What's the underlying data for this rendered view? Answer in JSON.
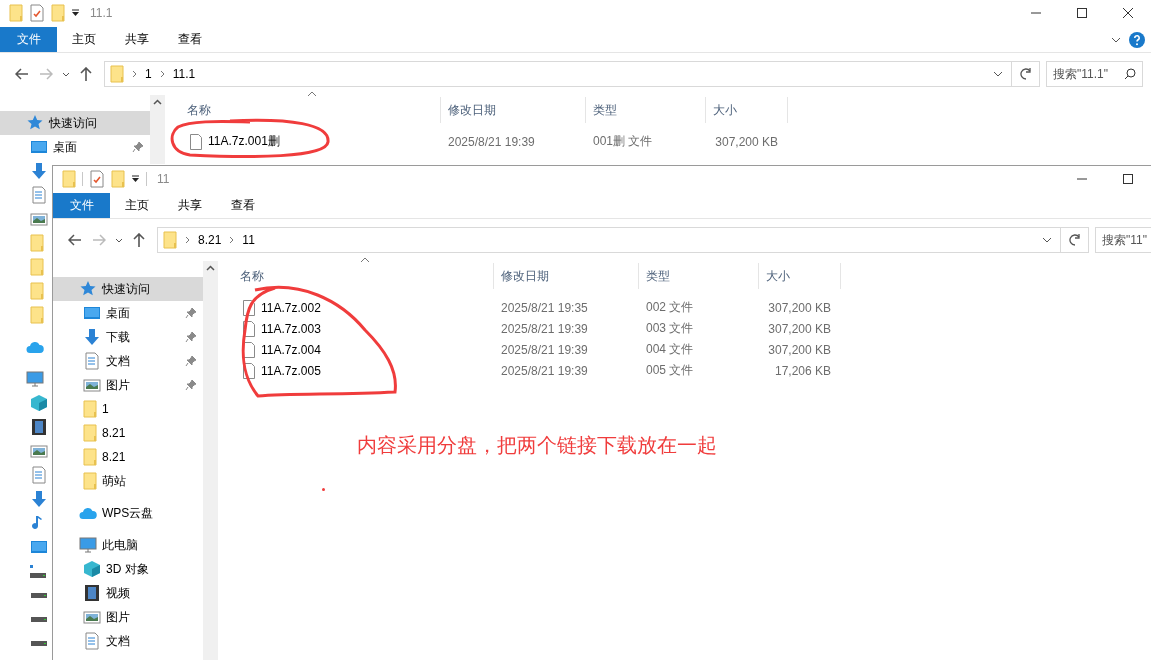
{
  "back_window": {
    "title": "11.1",
    "ribbon_tabs": [
      {
        "label": "文件",
        "selected": true
      },
      {
        "label": "主页",
        "selected": false
      },
      {
        "label": "共享",
        "selected": false
      },
      {
        "label": "查看",
        "selected": false
      }
    ],
    "path": [
      "1",
      "11.1"
    ],
    "search": {
      "placeholder": "搜索\"11.1\""
    },
    "nav": [
      {
        "kind": "star",
        "label": "快速访问",
        "selected": true
      },
      {
        "kind": "desktop",
        "label": "桌面",
        "pinned": true,
        "selected": false
      },
      {
        "kind": "download"
      },
      {
        "kind": "document"
      },
      {
        "kind": "picture"
      },
      {
        "kind": "folder"
      },
      {
        "kind": "folder"
      },
      {
        "kind": "folder"
      },
      {
        "kind": "folder"
      },
      {
        "kind": "cloud"
      },
      {
        "kind": "pc"
      },
      {
        "kind": "cube"
      },
      {
        "kind": "video"
      },
      {
        "kind": "picture"
      },
      {
        "kind": "document"
      },
      {
        "kind": "download"
      },
      {
        "kind": "music"
      },
      {
        "kind": "desktop"
      },
      {
        "kind": "windrive"
      },
      {
        "kind": "drive"
      },
      {
        "kind": "drive"
      },
      {
        "kind": "drive"
      }
    ],
    "columns": [
      "名称",
      "修改日期",
      "类型",
      "大小"
    ],
    "files": [
      {
        "name": "11A.7z.001删",
        "date": "2025/8/21 19:39",
        "type": "001删 文件",
        "size": "307,200 KB"
      }
    ]
  },
  "front_window": {
    "title": "11",
    "ribbon_tabs": [
      {
        "label": "文件",
        "selected": true
      },
      {
        "label": "主页",
        "selected": false
      },
      {
        "label": "共享",
        "selected": false
      },
      {
        "label": "查看",
        "selected": false
      }
    ],
    "path": [
      "8.21",
      "11"
    ],
    "search": {
      "placeholder": "搜索\"11\""
    },
    "nav": [
      {
        "kind": "star",
        "label": "快速访问",
        "selected": true
      },
      {
        "kind": "desktop",
        "label": "桌面",
        "pinned": true,
        "selected": false
      },
      {
        "kind": "download",
        "label": "下载",
        "pinned": true,
        "selected": false
      },
      {
        "kind": "document",
        "label": "文档",
        "pinned": true,
        "selected": false
      },
      {
        "kind": "picture",
        "label": "图片",
        "pinned": true,
        "selected": false
      },
      {
        "kind": "folder",
        "label": "1",
        "selected": false
      },
      {
        "kind": "folder",
        "label": "8.21",
        "selected": false
      },
      {
        "kind": "folder",
        "label": "8.21",
        "selected": false
      },
      {
        "kind": "folder",
        "label": "萌站",
        "selected": false
      },
      {
        "kind": "cloud",
        "label": "WPS云盘",
        "selected": false
      },
      {
        "kind": "pc",
        "label": "此电脑",
        "selected": false
      },
      {
        "kind": "cube",
        "label": "3D 对象",
        "selected": false
      },
      {
        "kind": "video",
        "label": "视频",
        "selected": false
      },
      {
        "kind": "picture",
        "label": "图片",
        "selected": false
      },
      {
        "kind": "document",
        "label": "文档",
        "selected": false
      }
    ],
    "columns": [
      "名称",
      "修改日期",
      "类型",
      "大小"
    ],
    "files": [
      {
        "name": "11A.7z.002",
        "date": "2025/8/21 19:35",
        "type": "002 文件",
        "size": "307,200 KB"
      },
      {
        "name": "11A.7z.003",
        "date": "2025/8/21 19:39",
        "type": "003 文件",
        "size": "307,200 KB"
      },
      {
        "name": "11A.7z.004",
        "date": "2025/8/21 19:39",
        "type": "004 文件",
        "size": "307,200 KB"
      },
      {
        "name": "11A.7z.005",
        "date": "2025/8/21 19:39",
        "type": "005 文件",
        "size": "17,206 KB"
      }
    ]
  },
  "annotation": {
    "note": "内容采用分盘，把两个链接下载放在一起"
  }
}
